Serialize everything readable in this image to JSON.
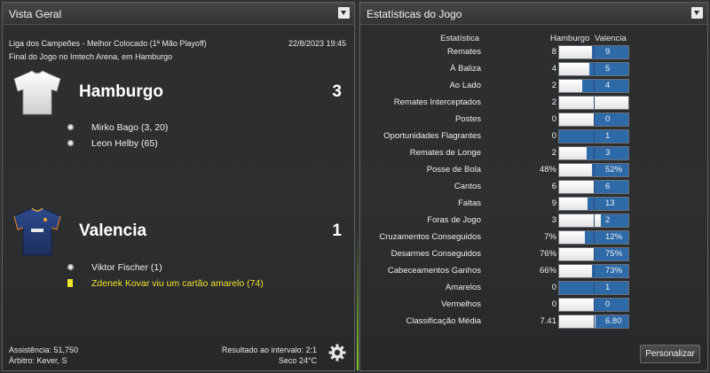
{
  "left_panel": {
    "title": "Vista Geral",
    "competition": "Liga dos Campeões - Melhor Colocado (1ª Mão Playoff)",
    "datetime": "22/8/2023 19:45",
    "venue": "Final do Jogo no Imtech Arena, em Hamburgo",
    "home": {
      "name": "Hamburgo",
      "score": "3",
      "events": [
        {
          "icon": "ball-icon",
          "text": "Mirko Bago (3, 20)"
        },
        {
          "icon": "ball-icon",
          "text": "Leon Helby (65)"
        }
      ]
    },
    "away": {
      "name": "Valencia",
      "score": "1",
      "events": [
        {
          "icon": "ball-icon",
          "text": "Viktor Fischer (1)"
        },
        {
          "icon": "yellow-card-icon",
          "text": "Zdenek Kovar viu um cartão amarelo (74)"
        }
      ]
    },
    "attendance": "Assistência: 51,750",
    "referee": "Árbitro: Kever, S",
    "halftime": "Resultado ao intervalo: 2:1",
    "weather": "Seco 24°C"
  },
  "right_panel": {
    "title": "Estatísticas do Jogo",
    "col_stat": "Estatística",
    "col_home": "Hamburgo",
    "col_away": "Valencia",
    "button_label": "Personalizar",
    "stats": [
      {
        "label": "Remates",
        "home": "8",
        "away": "9",
        "home_share": 0.47
      },
      {
        "label": "À Baliza",
        "home": "4",
        "away": "5",
        "home_share": 0.44
      },
      {
        "label": "Ao Lado",
        "home": "2",
        "away": "4",
        "home_share": 0.33
      },
      {
        "label": "Remates Interceptados",
        "home": "2",
        "away": "0",
        "home_share": 1.0
      },
      {
        "label": "Postes",
        "home": "0",
        "away": "0",
        "home_share": 0.5
      },
      {
        "label": "Oportunidades Flagrantes",
        "home": "0",
        "away": "1",
        "home_share": 0.0
      },
      {
        "label": "Remates de Longe",
        "home": "2",
        "away": "3",
        "home_share": 0.4
      },
      {
        "label": "Posse de Bola",
        "home": "48%",
        "away": "52%",
        "home_share": 0.48
      },
      {
        "label": "Cantos",
        "home": "6",
        "away": "6",
        "home_share": 0.5
      },
      {
        "label": "Faltas",
        "home": "9",
        "away": "13",
        "home_share": 0.41
      },
      {
        "label": "Foras de Jogo",
        "home": "3",
        "away": "2",
        "home_share": 0.6
      },
      {
        "label": "Cruzamentos Conseguidos",
        "home": "7%",
        "away": "12%",
        "home_share": 0.37
      },
      {
        "label": "Desarmes Conseguidos",
        "home": "76%",
        "away": "75%",
        "home_share": 0.5
      },
      {
        "label": "Cabeceamentos Ganhos",
        "home": "66%",
        "away": "73%",
        "home_share": 0.47
      },
      {
        "label": "Amarelos",
        "home": "0",
        "away": "1",
        "home_share": 0.0
      },
      {
        "label": "Vermelhos",
        "home": "0",
        "away": "0",
        "home_share": 0.5
      },
      {
        "label": "Classificação Média",
        "home": "7.41",
        "away": "6.80",
        "home_share": 0.52
      }
    ]
  },
  "colors": {
    "panel_bg": "#2d2f31",
    "away_bar": "#2e69a8",
    "home_bar": "#ffffff",
    "yellow_card": "#f2e32c",
    "accent_glow": "#7ec82a"
  }
}
